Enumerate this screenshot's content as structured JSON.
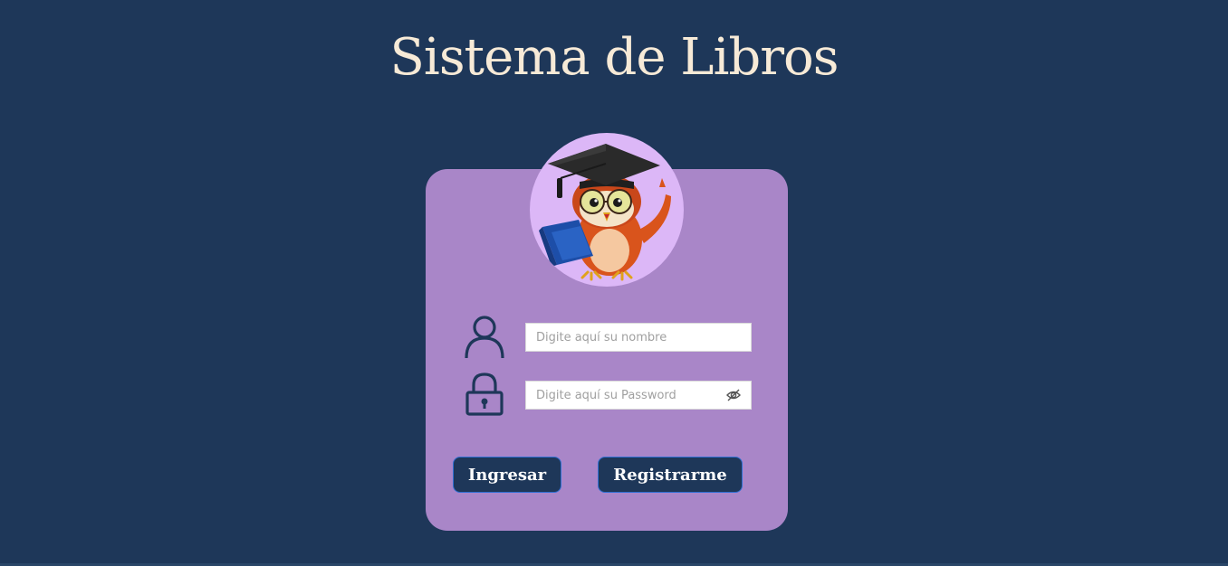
{
  "page": {
    "title": "Sistema de Libros"
  },
  "theme": {
    "background": "#1e3759",
    "card": "#a986c8",
    "avatar_bg": "#dcb7f7",
    "title_color": "#f7ead7",
    "button_bg": "#1e3759",
    "button_border": "#2f6fd3"
  },
  "avatar": {
    "icon": "graduate-owl-reading-book-icon"
  },
  "form": {
    "user_icon": "user-icon",
    "lock_icon": "lock-icon",
    "name_placeholder": "Digite aquí su nombre",
    "name_value": "",
    "password_placeholder": "Digite aquí su Password",
    "password_value": "",
    "password_toggle_icon": "eye-slash-icon"
  },
  "buttons": {
    "login_label": "Ingresar",
    "register_label": "Registrarme"
  }
}
